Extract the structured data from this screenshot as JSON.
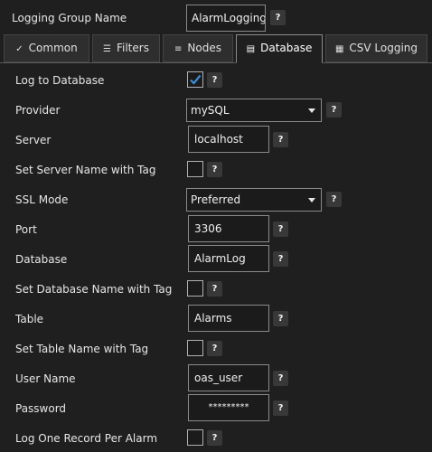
{
  "group": {
    "label": "Logging Group Name",
    "value": "AlarmLogging",
    "help": "?"
  },
  "tabs": [
    {
      "label": "Common",
      "icon": "checkmark-icon"
    },
    {
      "label": "Filters",
      "icon": "list-icon"
    },
    {
      "label": "Nodes",
      "icon": "nodes-icon"
    },
    {
      "label": "Database",
      "icon": "database-icon",
      "active": true
    },
    {
      "label": "CSV Logging",
      "icon": "csv-file-icon"
    }
  ],
  "fields": {
    "log_to_database": {
      "label": "Log to Database",
      "checked": true
    },
    "provider": {
      "label": "Provider",
      "value": "mySQL"
    },
    "server": {
      "label": "Server",
      "value": "localhost"
    },
    "server_tag": {
      "label": "Set Server Name with Tag",
      "checked": false
    },
    "ssl_mode": {
      "label": "SSL Mode",
      "value": "Preferred"
    },
    "port": {
      "label": "Port",
      "value": "3306"
    },
    "database": {
      "label": "Database",
      "value": "AlarmLog"
    },
    "database_tag": {
      "label": "Set Database Name with Tag",
      "checked": false
    },
    "table": {
      "label": "Table",
      "value": "Alarms"
    },
    "table_tag": {
      "label": "Set Table Name with Tag",
      "checked": false
    },
    "user_name": {
      "label": "User Name",
      "value": "oas_user"
    },
    "password": {
      "label": "Password",
      "value": "*********"
    },
    "one_record": {
      "label": "Log One Record Per Alarm",
      "checked": false
    }
  },
  "help_text": "?",
  "colors": {
    "accent": "#3b8fd9",
    "background": "#1f1f1f",
    "field_border": "#8a8a8a"
  }
}
